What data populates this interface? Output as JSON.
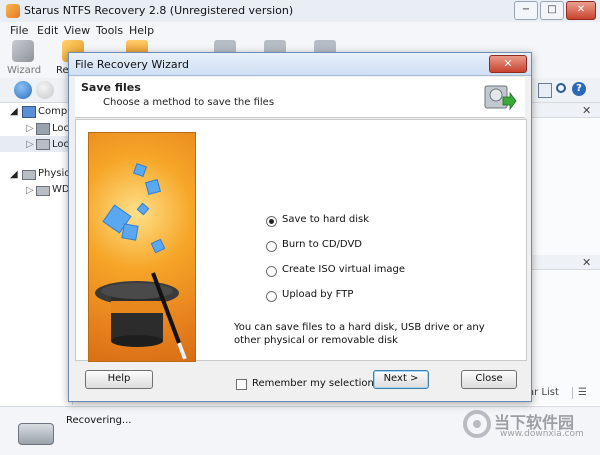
{
  "window": {
    "title": "Starus NTFS Recovery 2.8 (Unregistered version)",
    "min": "−",
    "max": "□",
    "close": "✕"
  },
  "menu": [
    "File",
    "Edit",
    "View",
    "Tools",
    "Help"
  ],
  "toolbar": {
    "wizard_label": "Wizard",
    "recover_label": "Re"
  },
  "tree": {
    "computer": "Compu",
    "local1": "Loca",
    "local2": "Loca",
    "physical": "Physica",
    "wd": "WD"
  },
  "list_label": "ar List",
  "status": {
    "text": "Recovering..."
  },
  "dialog": {
    "title": "File Recovery Wizard",
    "close": "✕",
    "header_title": "Save files",
    "header_subtitle": "Choose a method to save the files",
    "options": [
      "Save to hard disk",
      "Burn to CD/DVD",
      "Create ISO virtual image",
      "Upload by FTP"
    ],
    "selected": 0,
    "description": "You can save files to a hard disk, USB drive or any other physical or removable disk",
    "remember_label": "Remember my selection",
    "help_label": "Help",
    "next_label": "Next >",
    "close_label": "Close"
  },
  "watermark": {
    "brand": "当下软件园",
    "url": "www.downxia.com"
  },
  "colors": {
    "accent": "#3c7fb1",
    "illustration": "#f29a26"
  }
}
